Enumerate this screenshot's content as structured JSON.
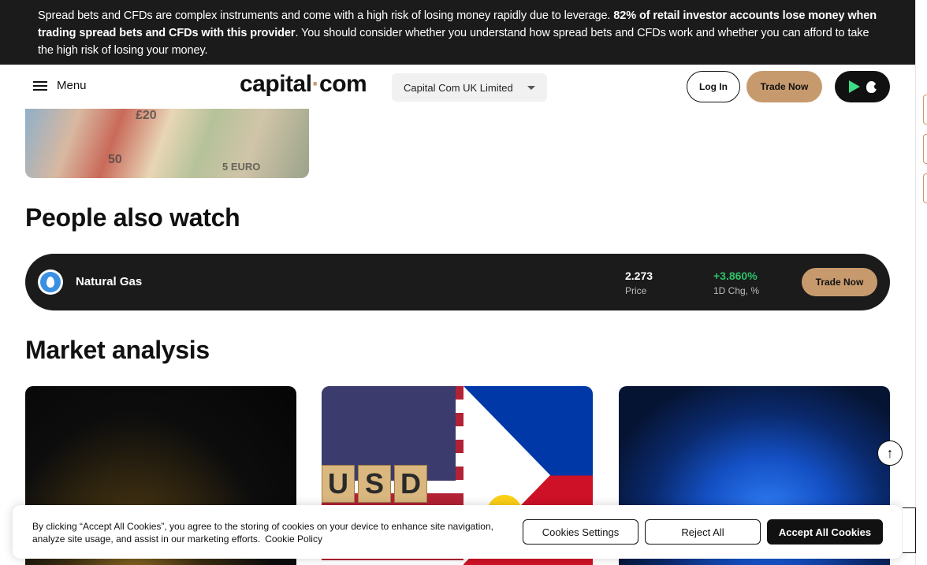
{
  "risk_banner": {
    "text_plain_1": "Spread bets and CFDs are complex instruments and come with a high risk of losing money rapidly due to leverage. ",
    "text_bold": "82% of retail investor accounts lose money when trading spread bets and CFDs with this provider",
    "text_plain_2": ". You should consider whether you understand how spread bets and CFDs work and whether you can afford to take the high risk of losing your money."
  },
  "header": {
    "menu_label": "Menu",
    "logo_part1": "capital",
    "logo_dot": "·",
    "logo_part2": "com",
    "entity_selected": "Capital Com UK Limited",
    "login_label": "Log In",
    "trade_now_label": "Trade Now",
    "app_icons": [
      "google-play-icon",
      "apple-icon"
    ]
  },
  "hero": {
    "note_1": "£20",
    "note_2": "50",
    "note_3": "5 EURO"
  },
  "people_also_watch": {
    "title": "People also watch",
    "items": [
      {
        "icon": "flame-icon",
        "name": "Natural Gas",
        "price": "2.273",
        "price_label": "Price",
        "change": "+3.860%",
        "change_label": "1D Chg, %",
        "trade_label": "Trade Now"
      }
    ]
  },
  "market_analysis": {
    "title": "Market analysis",
    "cards": [
      {
        "image": "gold"
      },
      {
        "image": "usd-php-flags",
        "blocks": [
          "U",
          "S",
          "D"
        ]
      },
      {
        "image": "gas-flame"
      }
    ]
  },
  "scroll_top_icon": "↑",
  "cookie_banner": {
    "text": "By clicking “Accept All Cookies”, you agree to the storing of cookies on your device to enhance site navigation, analyze site usage, and assist in our marketing efforts.",
    "policy_link": "Cookie Policy",
    "settings_label": "Cookies Settings",
    "reject_label": "Reject All",
    "accept_label": "Accept All Cookies"
  },
  "colors": {
    "brand_accent": "#c79a6d",
    "dark": "#1b1b1b",
    "positive": "#2ec36b"
  }
}
